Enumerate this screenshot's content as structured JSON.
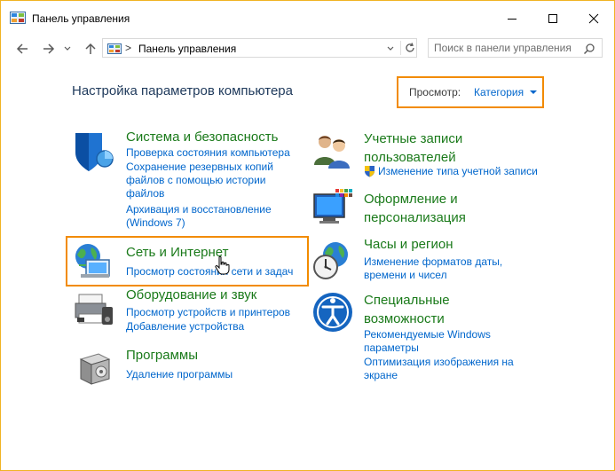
{
  "window": {
    "title": "Панель управления"
  },
  "address_bar": {
    "path_separator": ">",
    "path": "Панель управления",
    "search_placeholder": "Поиск в панели управления"
  },
  "header": {
    "page_title": "Настройка параметров компьютера",
    "view_label": "Просмотр:",
    "view_value": "Категория"
  },
  "categories": {
    "system": {
      "title": "Система и безопасность",
      "links": [
        "Проверка состояния компьютера",
        "Сохранение резервных копий файлов с помощью истории файлов",
        "Архивация и восстановление (Windows 7)"
      ]
    },
    "network": {
      "title": "Сеть и Интернет",
      "links": [
        "Просмотр состояния сети и задач"
      ]
    },
    "hardware": {
      "title": "Оборудование и звук",
      "links": [
        "Просмотр устройств и принтеров",
        "Добавление устройства"
      ]
    },
    "programs": {
      "title": "Программы",
      "links": [
        "Удаление программы"
      ]
    },
    "accounts": {
      "title": "Учетные записи пользователей",
      "links": [
        "Изменение типа учетной записи"
      ]
    },
    "appearance": {
      "title": "Оформление и персонализация",
      "links": []
    },
    "clock": {
      "title": "Часы и регион",
      "links": [
        "Изменение форматов даты, времени и чисел"
      ]
    },
    "ease": {
      "title": "Специальные возможности",
      "links": [
        "Рекомендуемые Windows параметры",
        "Оптимизация изображения на экране"
      ]
    }
  },
  "colors": {
    "window_border": "#f0b323",
    "highlight": "#f28b00",
    "title_green": "#1a7a1a",
    "link_blue": "#0066cc",
    "heading_blue": "#1e395b"
  }
}
